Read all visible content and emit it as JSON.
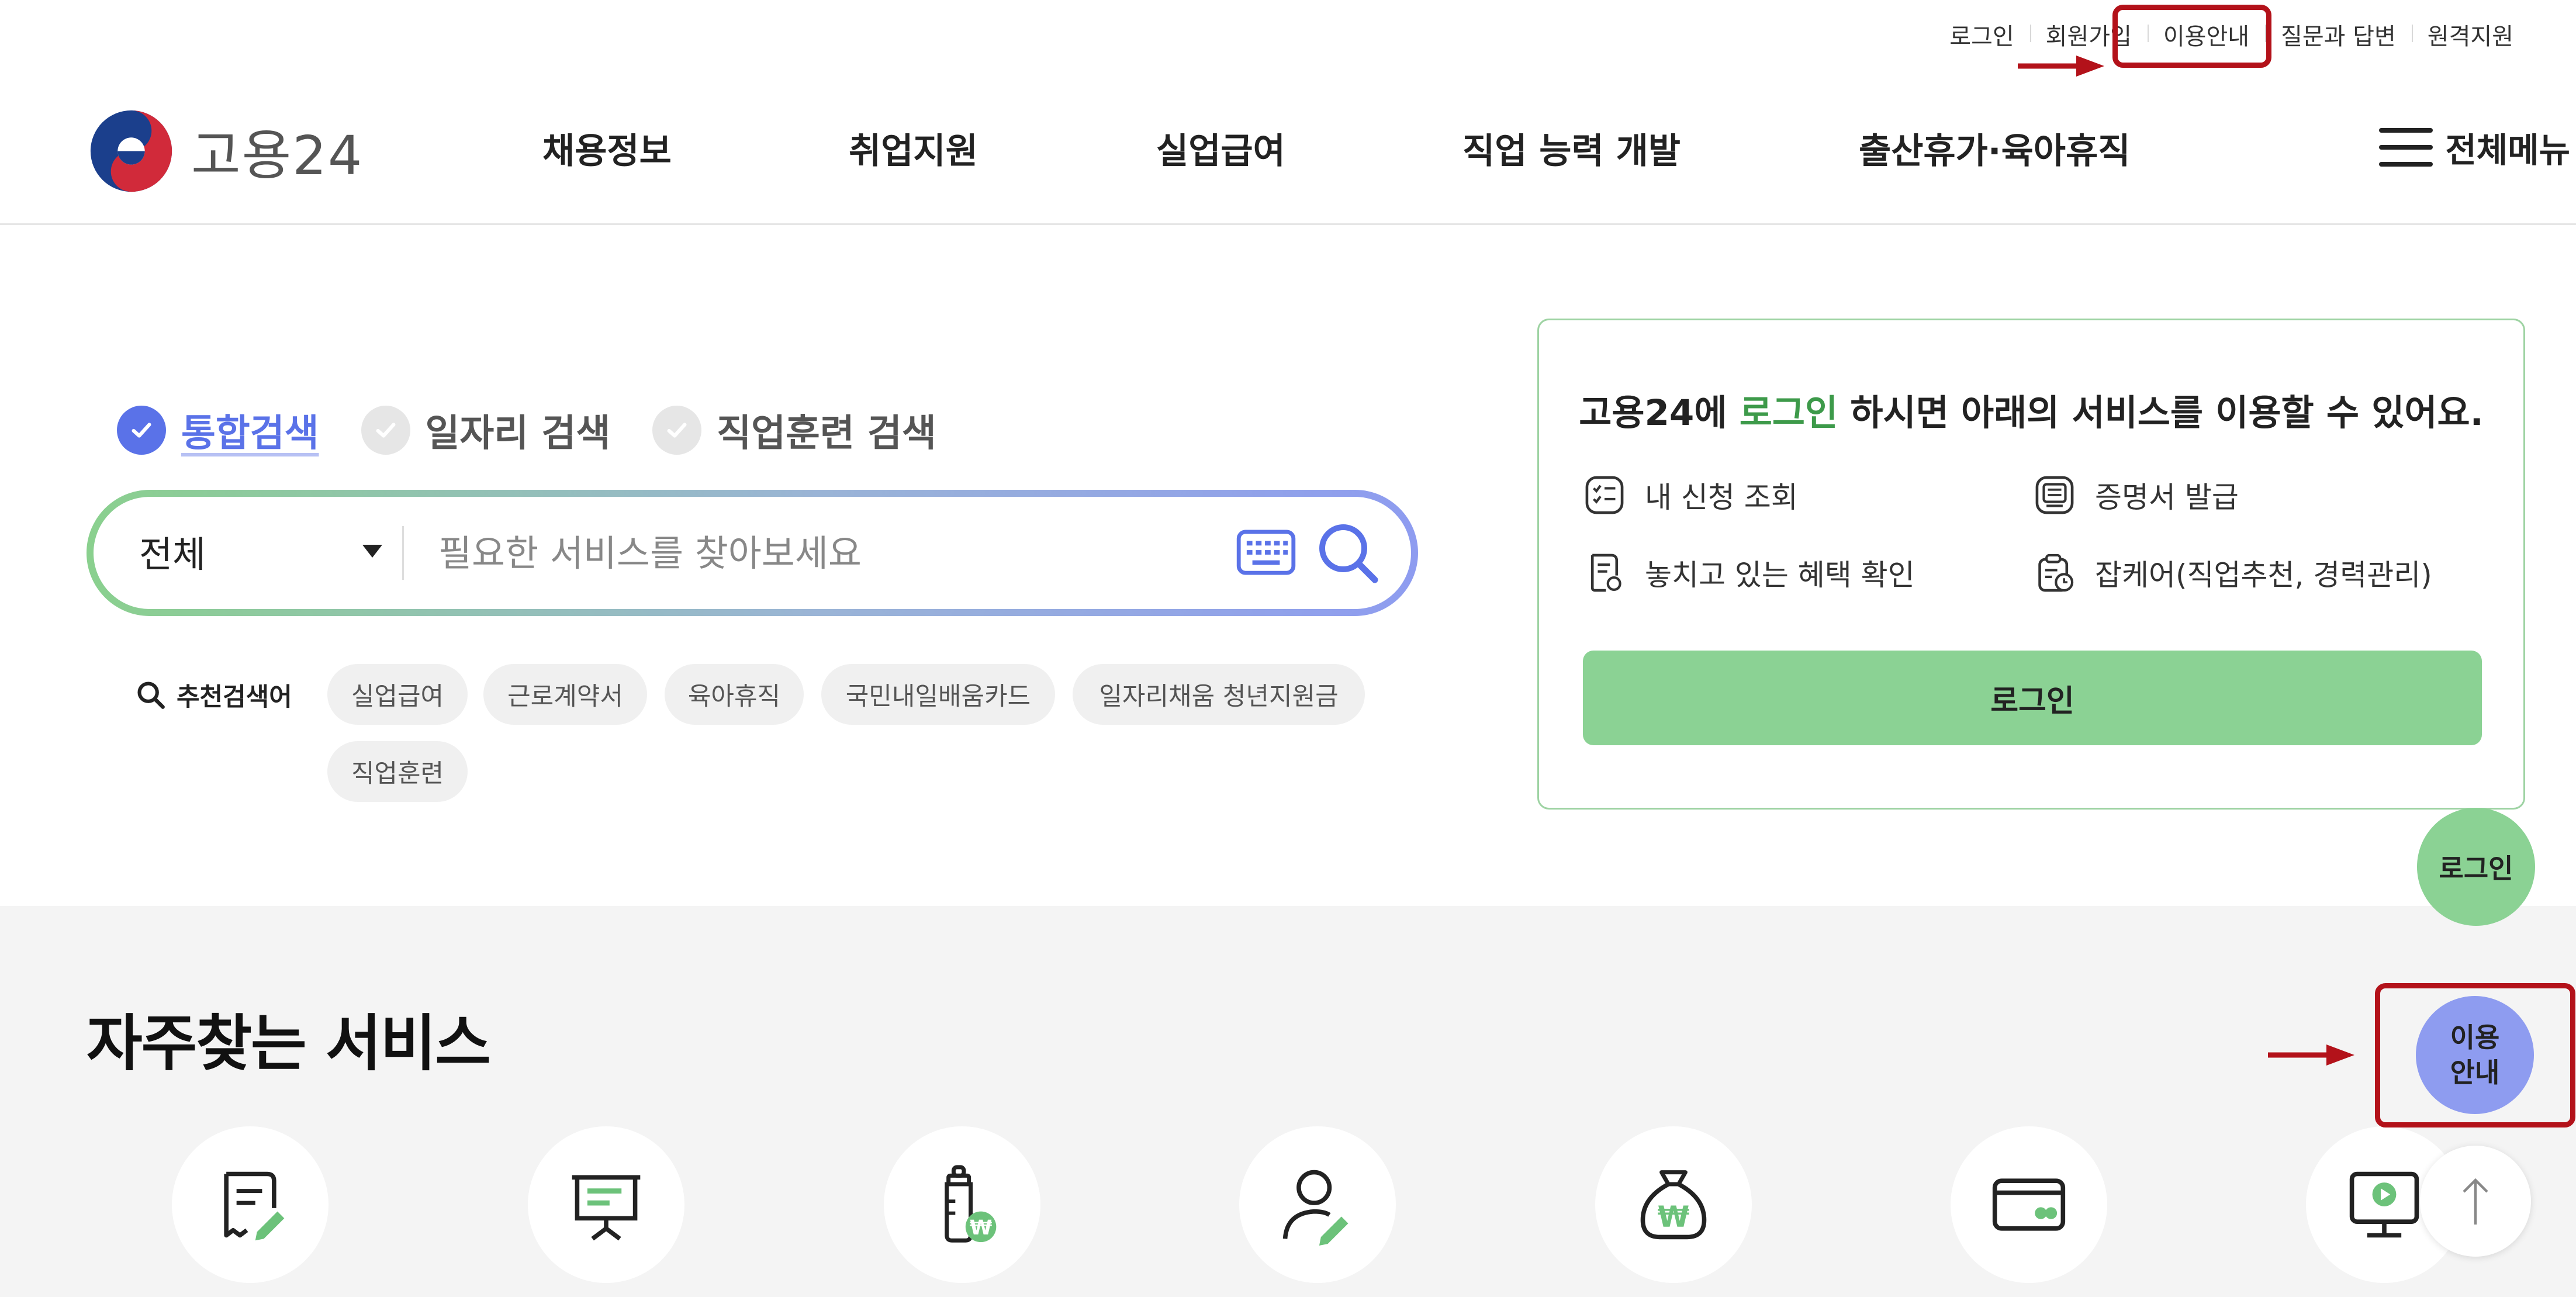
{
  "util_links": [
    "로그인",
    "회원가입",
    "이용안내",
    "질문과 답변",
    "원격지원"
  ],
  "logo": {
    "text": "고용24"
  },
  "nav": [
    "채용정보",
    "취업지원",
    "실업급여",
    "직업 능력 개발",
    "출산휴가·육아휴직"
  ],
  "all_menu_label": "전체메뉴",
  "search": {
    "tabs": [
      "통합검색",
      "일자리 검색",
      "직업훈련 검색"
    ],
    "active_tab": "통합검색",
    "scope": "전체",
    "placeholder": "필요한 서비스를 찾아보세요"
  },
  "recommended": {
    "label": "추천검색어",
    "keywords": [
      "실업급여",
      "근로계약서",
      "육아휴직",
      "국민내일배움카드",
      "일자리채움 청년지원금",
      "직업훈련"
    ]
  },
  "login_panel": {
    "title_prefix": "고용24에 ",
    "title_highlight": "로그인",
    "title_suffix": " 하시면 아래의 서비스를 이용할 수 있어요.",
    "items": [
      "내 신청 조회",
      "증명서 발급",
      "놓치고 있는 혜택 확인",
      "잡케어(직업추천, 경력관리)"
    ],
    "button": "로그인"
  },
  "services": {
    "title": "자주찾는 서비스",
    "icons": [
      "document-edit-icon",
      "presentation-board-icon",
      "baby-bottle-won-icon",
      "person-edit-icon",
      "money-bag-won-icon",
      "card-icon",
      "video-monitor-icon"
    ]
  },
  "floating": {
    "login": "로그인",
    "guide_line1": "이용",
    "guide_line2": "안내",
    "top_icon": "arrow-up-icon"
  },
  "colors": {
    "accent_green": "#8bd294",
    "accent_blue": "#8e9cf0",
    "annotation_red": "#b3121a"
  }
}
